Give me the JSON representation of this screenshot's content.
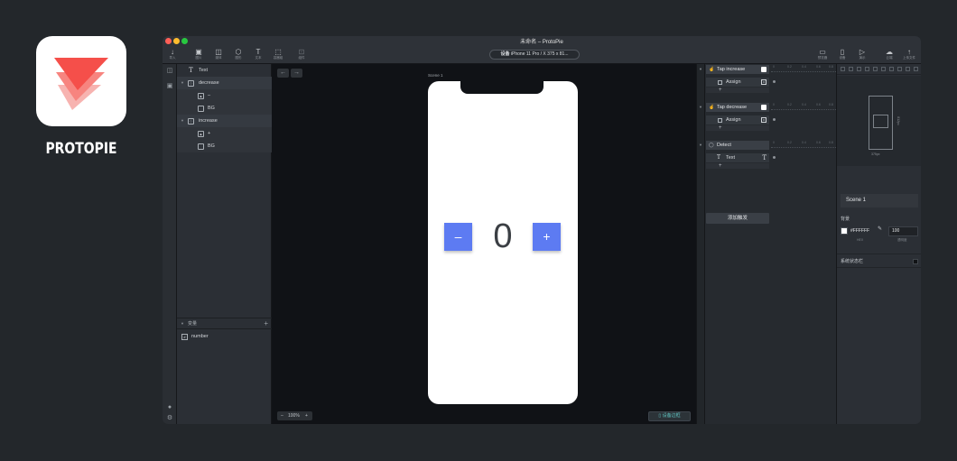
{
  "brand": {
    "name": "PROTOPIE"
  },
  "window": {
    "title": "未命名 – ProtoPie",
    "controls": {
      "close": "#ff5f57",
      "minimize": "#febc2e",
      "zoom": "#28c840"
    }
  },
  "toolbar": {
    "left": [
      {
        "icon": "arrow-down-icon",
        "label": "导入"
      },
      {
        "icon": "image-icon",
        "label": "图片"
      },
      {
        "icon": "media-icon",
        "label": "媒体"
      },
      {
        "icon": "shape-icon",
        "label": "图形"
      },
      {
        "icon": "text-icon",
        "label": "文本"
      },
      {
        "icon": "container-icon",
        "label": "容器组"
      },
      {
        "icon": "component-icon",
        "label": "组件"
      }
    ],
    "device_label": "设备",
    "device_value": "iPhone 11 Pro / X  375 x 81...",
    "right": [
      {
        "icon": "desktop-icon",
        "label": "预览器"
      },
      {
        "icon": "phone-icon",
        "label": "设备"
      },
      {
        "icon": "play-icon",
        "label": "演示"
      },
      {
        "icon": "cloud-icon",
        "label": "云端"
      },
      {
        "icon": "upload-icon",
        "label": "上传文件"
      }
    ]
  },
  "layers": [
    {
      "name": "Text",
      "type": "text",
      "level": 0
    },
    {
      "name": "decrease",
      "type": "group",
      "level": 0,
      "expanded": true
    },
    {
      "name": "–",
      "type": "image",
      "level": 1
    },
    {
      "name": "BG",
      "type": "rect",
      "level": 1
    },
    {
      "name": "increase",
      "type": "group",
      "level": 0,
      "expanded": true
    },
    {
      "name": "+",
      "type": "image",
      "level": 1
    },
    {
      "name": "BG",
      "type": "rect",
      "level": 1
    }
  ],
  "variables": {
    "header": "变量",
    "items": [
      {
        "name": "number"
      }
    ]
  },
  "canvas": {
    "scene_label": "Scene 1",
    "counter_value": "0",
    "minus_label": "–",
    "plus_label": "+",
    "accent": "#5d7bf2",
    "zoom_minus": "–",
    "zoom": "100%",
    "zoom_plus": "+",
    "mirror_button": "设备边框"
  },
  "interactions": {
    "triggers": [
      {
        "name": "Tap increase",
        "response": "Assign",
        "response_icon": "x"
      },
      {
        "name": "Tap decrease",
        "response": "Assign",
        "response_icon": "x"
      },
      {
        "name": "Detect",
        "response": "Text",
        "response_icon": "T"
      }
    ],
    "ruler_ticks": [
      "0",
      "0.2",
      "0.4",
      "0.6",
      "0.8"
    ],
    "add_trigger": "添加触发",
    "add_response": "+"
  },
  "properties": {
    "preview_width": "375px",
    "preview_height": "812px",
    "scene_name": "Scene 1",
    "background_label": "背景",
    "background_color": "#FFFFFF",
    "opacity": "100",
    "color_sub": "HEX",
    "opacity_sub": "透明度",
    "status_bar": "系统状态栏"
  }
}
